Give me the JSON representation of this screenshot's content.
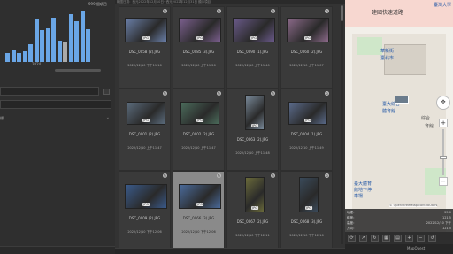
{
  "left": {
    "histogram_label": "999 個項目",
    "histogram_year": "2024",
    "histogram_levels": [
      0.16,
      0.24,
      0.16,
      0.2,
      0.34,
      0.8,
      0.6,
      0.64,
      0.84,
      0.4,
      0.36,
      0.9,
      0.76,
      0.96,
      0.62
    ],
    "histogram_selected_index": 10,
    "section_title": "標",
    "footer_text": ""
  },
  "mid": {
    "header_text": "範圍日期：西元2022年12月10日~西元2022年12月31日 顯示項目",
    "cells": [
      {
        "name": "DSC_0058 (2).JPG",
        "date": "2022/12/10 下午11:16",
        "badge": "JPG",
        "bg": "#6a7fa8",
        "selected": false
      },
      {
        "name": "DSC_0085 (3).JPG",
        "date": "2022/12/10 上午11:26",
        "badge": "JPG",
        "bg": "#7b5f8e",
        "selected": false
      },
      {
        "name": "DSC_0090 (1).JPG",
        "date": "2022/12/10 上午11:40",
        "badge": "JPG",
        "bg": "#6a5a8a",
        "selected": false
      },
      {
        "name": "DSC_0060 (2).JPG",
        "date": "2022/12/10 上午11:07",
        "badge": "JPG",
        "bg": "#8c6a8a",
        "selected": false
      },
      {
        "name": "DSC_0001 (2).JPG",
        "date": "2022/12/10 上午11:47",
        "badge": "JPG",
        "bg": "#5a6a7a",
        "selected": false
      },
      {
        "name": "DSC_0002 (2).JPG",
        "date": "2022/12/10 上午11:47",
        "badge": "JPG",
        "bg": "#4a6a5a",
        "selected": false
      },
      {
        "name": "DSC_0063 (2).JPG",
        "date": "2022/12/10 上午11:48",
        "badge": "JPG",
        "bg": "#7a8a9a",
        "selected": false
      },
      {
        "name": "DSC_0004 (1).JPG",
        "date": "2022/12/10 上午11:49",
        "badge": "JPG",
        "bg": "#5a6a8a",
        "selected": false
      },
      {
        "name": "DSC_0009 (2).JPG",
        "date": "2022/12/10 下午12:06",
        "badge": "JPG",
        "bg": "#3a5a8a",
        "selected": false
      },
      {
        "name": "DSC_0066 (3).JPG",
        "date": "2022/12/10 下午12:06",
        "badge": "JPG",
        "bg": "#4a6a9a",
        "selected": true
      },
      {
        "name": "DSC_0067 (2).JPG",
        "date": "2022/12/10 下午12:11",
        "badge": "JPG",
        "bg": "#6a6a3a",
        "selected": false
      },
      {
        "name": "DSC_0068 (3).JPG",
        "date": "2022/12/10 下午12:16",
        "badge": "JPG",
        "bg": "#3a4a5a",
        "selected": false
      }
    ]
  },
  "map": {
    "road_label": "建國快速道路",
    "labels": [
      "臺灣大學",
      "華新街",
      "臺北市",
      "臺大綜合",
      "體育館",
      "綜合",
      "育館",
      "臺大體育",
      "館地下停",
      "車場"
    ],
    "attribution": "© OpenStreetMap contributors",
    "info": {
      "left_lines": [
        "地緯：",
        "緯度：",
        "高度：",
        "方向："
      ],
      "right_lines": [
        "25.0",
        "121.5",
        "2022/12/10 下午",
        "121.5"
      ]
    },
    "toolbar_icons": [
      "sync-icon",
      "link-icon",
      "refresh-icon",
      "grid-icon",
      "layers-icon",
      "zoom-in-icon",
      "zoom-out-icon",
      "rotate-icon"
    ],
    "toolbar_glyphs": [
      "⟳",
      "↗",
      "↻",
      "▦",
      "▤",
      "+",
      "−",
      "↺"
    ],
    "footer_select": "MapQuest"
  }
}
